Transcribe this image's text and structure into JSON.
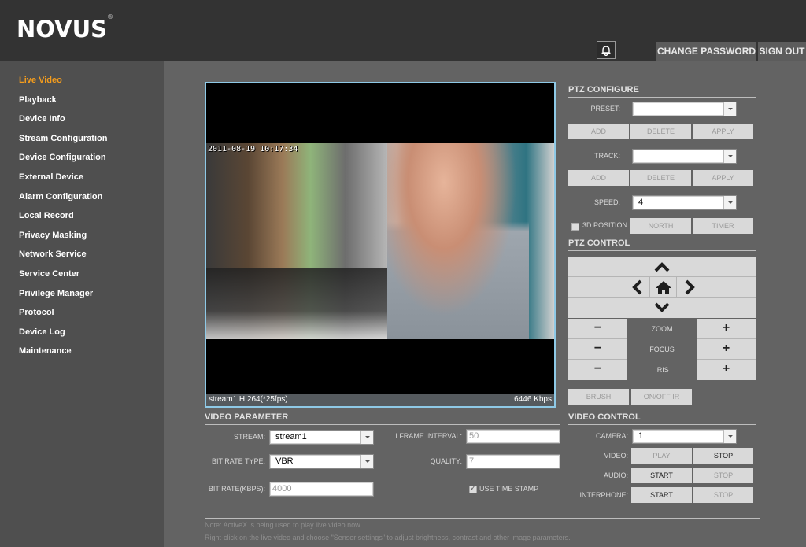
{
  "header": {
    "logo": "NOVUS",
    "logo_mark": "®",
    "notification_icon": "bell-icon",
    "change_password": "CHANGE PASSWORD",
    "sign_out": "SIGN OUT"
  },
  "sidebar": {
    "items": [
      {
        "label": "Live Video",
        "active": true
      },
      {
        "label": "Playback"
      },
      {
        "label": "Device Info"
      },
      {
        "label": "Stream Configuration"
      },
      {
        "label": "Device Configuration"
      },
      {
        "label": "External Device"
      },
      {
        "label": "Alarm Configuration"
      },
      {
        "label": "Local Record"
      },
      {
        "label": "Privacy Masking"
      },
      {
        "label": "Network Service"
      },
      {
        "label": "Service Center"
      },
      {
        "label": "Privilege Manager"
      },
      {
        "label": "Protocol"
      },
      {
        "label": "Device Log"
      },
      {
        "label": "Maintenance"
      }
    ],
    "active_color": "#f39c1d"
  },
  "video": {
    "timestamp": "2011-08-19 10:17:34",
    "stream_info": "stream1:H.264(*25fps)",
    "bitrate": "6446 Kbps",
    "border_color": "#8ec9e6"
  },
  "ptz_configure": {
    "title": "PTZ CONFIGURE",
    "preset_label": "PRESET:",
    "preset_value": "",
    "track_label": "TRACK:",
    "track_value": "",
    "speed_label": "SPEED:",
    "speed_value": "4",
    "add": "ADD",
    "delete": "DELETE",
    "apply": "APPLY",
    "position_3d": "3D POSITION",
    "position_3d_checked": false,
    "north": "NORTH",
    "timer": "TIMER"
  },
  "ptz_control": {
    "title": "PTZ CONTROL",
    "zoom": "ZOOM",
    "focus": "FOCUS",
    "iris": "IRIS",
    "minus": "−",
    "plus": "+",
    "brush": "BRUSH",
    "ir": "ON/OFF IR"
  },
  "video_parameter": {
    "title": "VIDEO PARAMETER",
    "stream_label": "STREAM:",
    "stream_value": "stream1",
    "bitrate_type_label": "BIT RATE TYPE:",
    "bitrate_type_value": "VBR",
    "bitrate_label": "BIT RATE(KBPS):",
    "bitrate_value": "4000",
    "iframe_label": "I FRAME INTERVAL:",
    "iframe_value": "50",
    "quality_label": "QUALITY:",
    "quality_value": "7",
    "timestamp_label": "USE TIME STAMP",
    "timestamp_checked": true
  },
  "video_control": {
    "title": "VIDEO CONTROL",
    "camera_label": "CAMERA:",
    "camera_value": "1",
    "video_label": "VIDEO:",
    "audio_label": "AUDIO:",
    "interphone_label": "INTERPHONE:",
    "play": "PLAY",
    "stop": "STOP",
    "start": "START"
  },
  "notes": {
    "line1": "Note: ActiveX is being used to play live video now.",
    "line2": "Right-click on the live video and choose \"Sensor settings\" to adjust brightness, contrast and other image parameters."
  }
}
